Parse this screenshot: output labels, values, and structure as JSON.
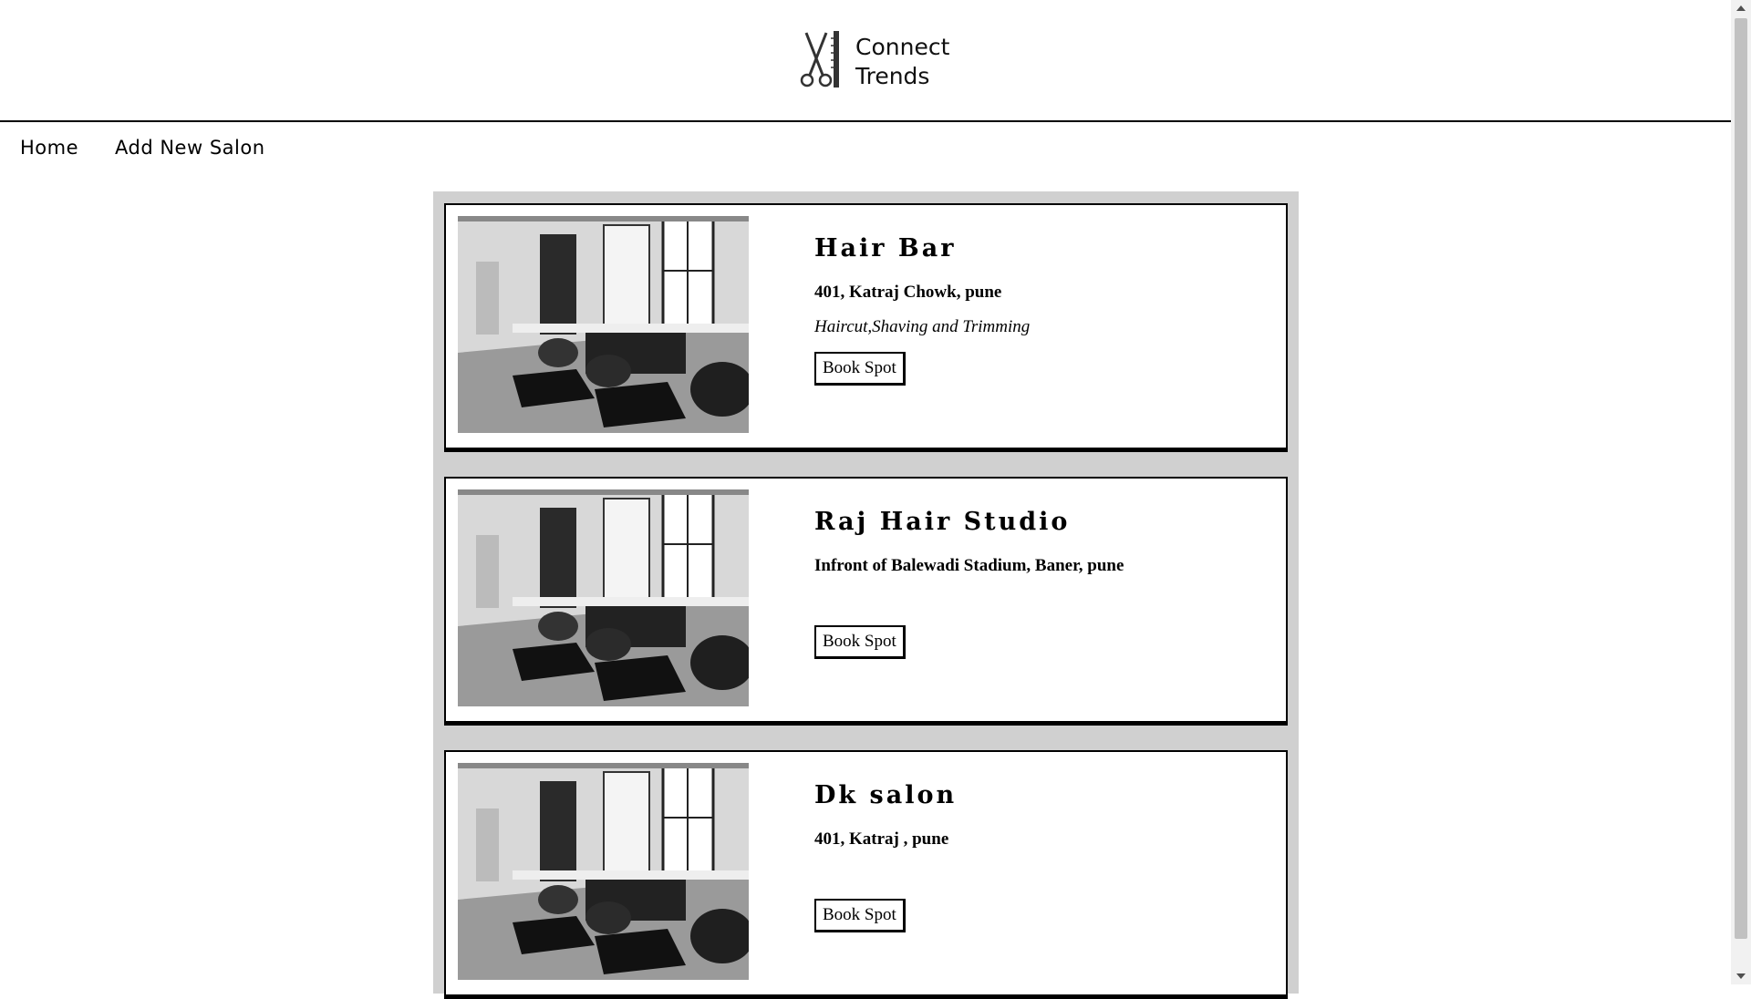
{
  "brand": {
    "line1": "Connect",
    "line2": "Trends",
    "logo_icon": "scissors-comb-icon"
  },
  "nav": {
    "home": "Home",
    "add_salon": "Add New Salon"
  },
  "salons": [
    {
      "name": "Hair Bar",
      "address": "401, Katraj Chowk, pune",
      "services": "Haircut,Shaving and Trimming",
      "button": "Book Spot"
    },
    {
      "name": "Raj Hair Studio",
      "address": "Infront of Balewadi Stadium, Baner, pune",
      "services": "",
      "button": "Book Spot"
    },
    {
      "name": "Dk salon",
      "address": "401, Katraj , pune",
      "services": "",
      "button": "Book Spot"
    }
  ],
  "colors": {
    "list_bg": "#d0d0d0",
    "border": "#000000",
    "background": "#ffffff"
  }
}
